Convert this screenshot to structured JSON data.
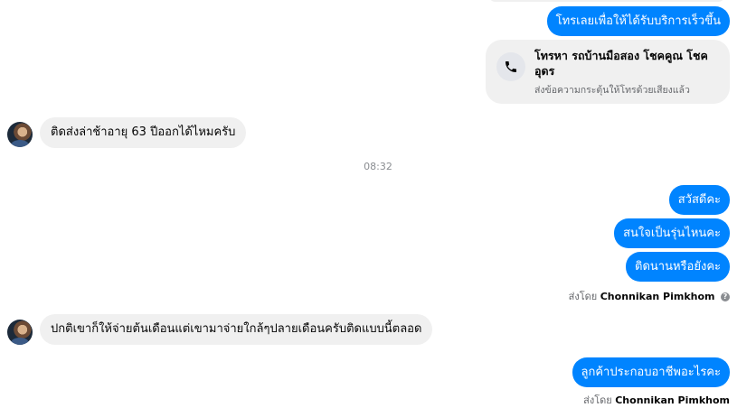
{
  "thread": {
    "messages": [
      {
        "text": "โทรเลยเพื่อให้ได้รับบริการเร็วขึ้น"
      },
      {
        "text": "ติดส่งล่าช้าอายุ 63 ปีออกได้ไหมครับ"
      },
      {
        "text": "สวัสดีคะ"
      },
      {
        "text": "สนใจเป็นรุ่นไหนคะ"
      },
      {
        "text": "ติดนานหรือยังคะ"
      },
      {
        "text": "ปกติเขาก็ให้จ่ายต้นเดือนแต่เขามาจ่ายใกล้ๆปลายเดือนครับติดแบบนี้ตลอด"
      },
      {
        "text": "ลูกค้าประกอบอาชีพอะไรคะ"
      }
    ],
    "call_card": {
      "icon": "phone-icon",
      "title": "โทรหา รถบ้านมือสอง โชคคูณ โชคอุดร",
      "subtitle": "ส่งข้อความกระตุ้นให้โทรด้วยเสียงแล้ว"
    },
    "timestamp": "08:32",
    "sent_by": {
      "prefix": "ส่งโดย",
      "name": "Chonnikan Pimkhom",
      "partial_name": "Chonnikan Pimkhom"
    }
  },
  "colors": {
    "outgoing_bubble": "#0084ff",
    "incoming_bubble": "#f0f0f0"
  }
}
